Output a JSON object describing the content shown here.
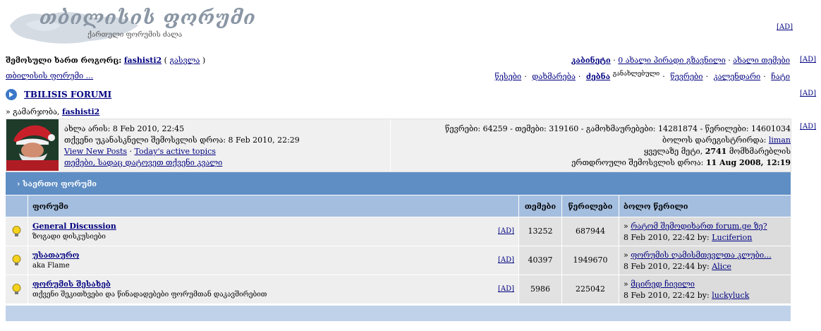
{
  "logo": {
    "title": "თბილისის ფორუმი",
    "subtitle": "ქართული ფორუმის ძალა"
  },
  "ad_label": "[AD]",
  "welcome": {
    "prefix": "შემოსული ხართ როგორც:",
    "username": "fashisti2",
    "logout": "გასვლა"
  },
  "top_links": {
    "cabinet": "კაბინეტი",
    "messages": "0 ახალი პირადი გზავნილი",
    "new_topic": "ახალი თემები"
  },
  "breadcrumb": "თბილისის ფორუმი ...",
  "nav": {
    "rules": "წესები",
    "help": "დახმარება",
    "search": "ძებნა",
    "search_sub": "განახლებული",
    "members": "წევრები",
    "calendar": "კალენდარი",
    "chat": "ჩატი"
  },
  "forum_title": "TBILISIS FORUMI",
  "greeting": {
    "prefix": "» გამარჯობა,",
    "username": "fashisti2"
  },
  "info": {
    "now": "ახლა არის: 8 Feb 2010, 22:45",
    "last_visit": "თქვენი უკანასკნელი შემოსვლის დროა: 8 Feb 2010, 22:29",
    "view_new": "View New Posts",
    "active_topics": "Today's active topics",
    "my_topics": "თემები, სადაც დატოვეთ თქვენი კვალი",
    "stats": "წევრები: 64259 - თემები: 319160 - გამოხმაურებები: 14281874 - წერილები: 14601034",
    "last_member_prefix": "ბოლოს დარეგისტრირდა:",
    "last_member": "liman",
    "most_online_prefix": "ყველაზე მეტი,",
    "most_online_count": "2741",
    "most_online_suffix": "მომხმარებლის",
    "record_prefix": "ერთდროული შემოსვლის დროა:",
    "record_date": "11 Aug 2008, 12:19"
  },
  "category": "› საერთო ფორუმი",
  "headers": {
    "forum": "ფორუმი",
    "topics": "თემები",
    "posts": "წერილები",
    "last_post": "ბოლო წერილი"
  },
  "forums": [
    {
      "name": "General Discussion",
      "desc": "ზოგადი დისკუსიები",
      "topics": "13252",
      "posts": "687944",
      "last_title": "რატომ შემოდიხართ forum.ge ზე?",
      "last_date": "8 Feb 2010, 22:42 by:",
      "last_user": "Luciferion"
    },
    {
      "name": "უსათაურო",
      "desc": "aka Flame",
      "topics": "40397",
      "posts": "1949670",
      "last_title": "ფორუმის ღამისმთევლთა კლუბი...",
      "last_date": "8 Feb 2010, 22:44 by:",
      "last_user": "Alice"
    },
    {
      "name": "ფორუმის შესახებ",
      "desc": "თქვენი შეკითხვები და წინადადებები ფორუმთან დაკავშირებით",
      "topics": "5986",
      "posts": "225042",
      "last_title": "მცირედ ჩივილი",
      "last_date": "8 Feb 2010, 22:42 by:",
      "last_user": "luckyluck"
    }
  ],
  "colors": {
    "category_bg": "#5f8ec4",
    "header_bg": "#a4bedf",
    "link": "#000080",
    "footer_bg": "#c0d2ea"
  }
}
